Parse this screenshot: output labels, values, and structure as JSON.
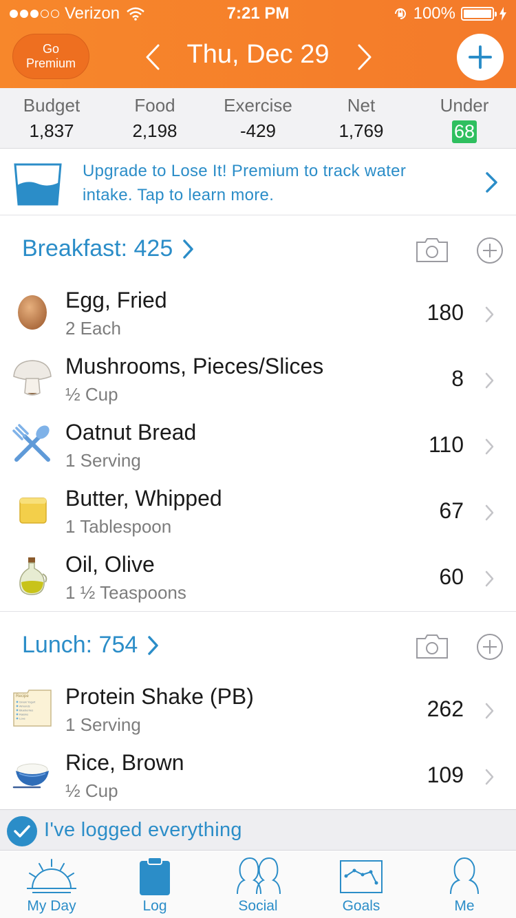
{
  "status_bar": {
    "carrier": "Verizon",
    "time": "7:21 PM",
    "battery": "100%"
  },
  "header": {
    "go_premium_line1": "Go",
    "go_premium_line2": "Premium",
    "date": "Thu, Dec 29"
  },
  "summary": [
    {
      "label": "Budget",
      "value": "1,837"
    },
    {
      "label": "Food",
      "value": "2,198"
    },
    {
      "label": "Exercise",
      "value": "-429"
    },
    {
      "label": "Net",
      "value": "1,769"
    },
    {
      "label": "Under",
      "value": "68"
    }
  ],
  "water_banner": {
    "text": "Upgrade to Lose It! Premium to track water intake. Tap to learn more."
  },
  "meals": {
    "breakfast": {
      "title": "Breakfast: 425",
      "items": [
        {
          "name": "Egg, Fried",
          "portion": "2 Each",
          "calories": "180",
          "icon": "egg-icon"
        },
        {
          "name": "Mushrooms, Pieces/Slices",
          "portion": "½ Cup",
          "calories": "8",
          "icon": "mushroom-icon"
        },
        {
          "name": "Oatnut Bread",
          "portion": "1 Serving",
          "calories": "110",
          "icon": "fork-spoon-icon"
        },
        {
          "name": "Butter, Whipped",
          "portion": "1 Tablespoon",
          "calories": "67",
          "icon": "butter-icon"
        },
        {
          "name": "Oil, Olive",
          "portion": "1 ½ Teaspoons",
          "calories": "60",
          "icon": "olive-oil-icon"
        }
      ]
    },
    "lunch": {
      "title": "Lunch: 754",
      "items": [
        {
          "name": "Protein Shake (PB)",
          "portion": "1 Serving",
          "calories": "262",
          "icon": "recipe-card-icon"
        },
        {
          "name": "Rice, Brown",
          "portion": "½ Cup",
          "calories": "109",
          "icon": "rice-bowl-icon"
        }
      ]
    }
  },
  "recipe_card": {
    "title": "Recipe",
    "lines": [
      "Greek Yogurt",
      "Almonds",
      "Blueberries",
      "Raisins",
      "Love"
    ]
  },
  "logged_bar": {
    "text": "I've logged everything"
  },
  "tabs": [
    {
      "label": "My Day",
      "icon": "sunrise-icon"
    },
    {
      "label": "Log",
      "icon": "clipboard-icon"
    },
    {
      "label": "Social",
      "icon": "people-icon"
    },
    {
      "label": "Goals",
      "icon": "graph-icon"
    },
    {
      "label": "Me",
      "icon": "person-icon"
    }
  ],
  "colors": {
    "header_orange": "#f47a2a",
    "accent_blue": "#2b8dc8",
    "under_green": "#2fbf5f"
  }
}
